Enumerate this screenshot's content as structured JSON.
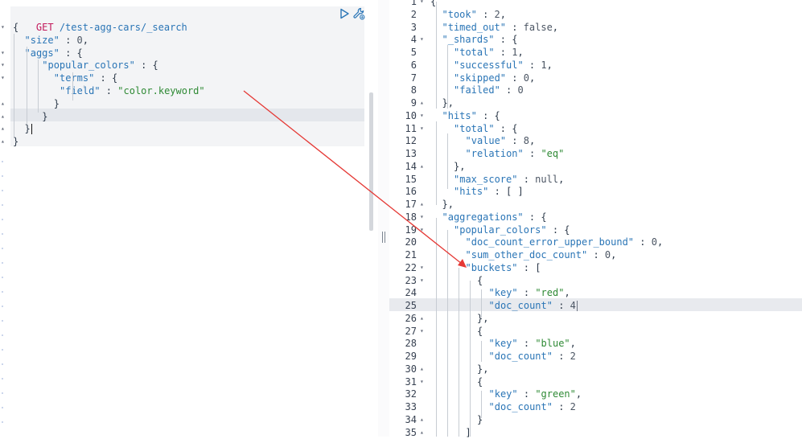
{
  "request": {
    "method": "GET",
    "path": "/test-agg-cars/_search"
  },
  "colors": {
    "method": "#c2185b",
    "key": "#2a75b6",
    "string": "#2f8a35",
    "arrow": "#e53935",
    "highlight": "#f3f4f6"
  },
  "icons": [
    "play-icon",
    "wrench-icon"
  ],
  "editor_lines": [
    [
      {
        "t": "pun",
        "v": "{"
      }
    ],
    [
      {
        "t": "key",
        "v": "\"size\""
      },
      {
        "t": "pun",
        "v": " : "
      },
      {
        "t": "num",
        "v": "0"
      },
      {
        "t": "pun",
        "v": ","
      }
    ],
    [
      {
        "t": "key",
        "v": "\"aggs\""
      },
      {
        "t": "pun",
        "v": " : {"
      }
    ],
    [
      {
        "t": "key",
        "v": "\"popular_colors\""
      },
      {
        "t": "pun",
        "v": " : {"
      }
    ],
    [
      {
        "t": "key",
        "v": "\"terms\""
      },
      {
        "t": "pun",
        "v": " : {"
      }
    ],
    [
      {
        "t": "key",
        "v": "\"field\""
      },
      {
        "t": "pun",
        "v": " : "
      },
      {
        "t": "str",
        "v": "\"color.keyword\""
      }
    ],
    [
      {
        "t": "pun",
        "v": "}"
      }
    ],
    [
      {
        "t": "pun",
        "v": "}"
      }
    ],
    [
      {
        "t": "pun",
        "v": "}"
      }
    ],
    [
      {
        "t": "pun",
        "v": "}"
      }
    ]
  ],
  "response_lines": [
    {
      "n": "1",
      "f": "▾",
      "c": [
        {
          "t": "pun",
          "v": "{"
        }
      ]
    },
    {
      "n": "2",
      "f": "",
      "c": [
        {
          "t": "key",
          "v": "\"took\""
        },
        {
          "t": "pun",
          "v": " : "
        },
        {
          "t": "num",
          "v": "2"
        },
        {
          "t": "pun",
          "v": ","
        }
      ]
    },
    {
      "n": "3",
      "f": "",
      "c": [
        {
          "t": "key",
          "v": "\"timed_out\""
        },
        {
          "t": "pun",
          "v": " : "
        },
        {
          "t": "kw",
          "v": "false"
        },
        {
          "t": "pun",
          "v": ","
        }
      ]
    },
    {
      "n": "4",
      "f": "▾",
      "c": [
        {
          "t": "key",
          "v": "\"_shards\""
        },
        {
          "t": "pun",
          "v": " : {"
        }
      ]
    },
    {
      "n": "5",
      "f": "",
      "c": [
        {
          "t": "key",
          "v": "\"total\""
        },
        {
          "t": "pun",
          "v": " : "
        },
        {
          "t": "num",
          "v": "1"
        },
        {
          "t": "pun",
          "v": ","
        }
      ]
    },
    {
      "n": "6",
      "f": "",
      "c": [
        {
          "t": "key",
          "v": "\"successful\""
        },
        {
          "t": "pun",
          "v": " : "
        },
        {
          "t": "num",
          "v": "1"
        },
        {
          "t": "pun",
          "v": ","
        }
      ]
    },
    {
      "n": "7",
      "f": "",
      "c": [
        {
          "t": "key",
          "v": "\"skipped\""
        },
        {
          "t": "pun",
          "v": " : "
        },
        {
          "t": "num",
          "v": "0"
        },
        {
          "t": "pun",
          "v": ","
        }
      ]
    },
    {
      "n": "8",
      "f": "",
      "c": [
        {
          "t": "key",
          "v": "\"failed\""
        },
        {
          "t": "pun",
          "v": " : "
        },
        {
          "t": "num",
          "v": "0"
        }
      ]
    },
    {
      "n": "9",
      "f": "▴",
      "c": [
        {
          "t": "pun",
          "v": "},"
        }
      ]
    },
    {
      "n": "10",
      "f": "▾",
      "c": [
        {
          "t": "key",
          "v": "\"hits\""
        },
        {
          "t": "pun",
          "v": " : {"
        }
      ]
    },
    {
      "n": "11",
      "f": "▾",
      "c": [
        {
          "t": "key",
          "v": "\"total\""
        },
        {
          "t": "pun",
          "v": " : {"
        }
      ]
    },
    {
      "n": "12",
      "f": "",
      "c": [
        {
          "t": "key",
          "v": "\"value\""
        },
        {
          "t": "pun",
          "v": " : "
        },
        {
          "t": "num",
          "v": "8"
        },
        {
          "t": "pun",
          "v": ","
        }
      ]
    },
    {
      "n": "13",
      "f": "",
      "c": [
        {
          "t": "key",
          "v": "\"relation\""
        },
        {
          "t": "pun",
          "v": " : "
        },
        {
          "t": "str",
          "v": "\"eq\""
        }
      ]
    },
    {
      "n": "14",
      "f": "▴",
      "c": [
        {
          "t": "pun",
          "v": "},"
        }
      ]
    },
    {
      "n": "15",
      "f": "",
      "c": [
        {
          "t": "key",
          "v": "\"max_score\""
        },
        {
          "t": "pun",
          "v": " : "
        },
        {
          "t": "kw",
          "v": "null"
        },
        {
          "t": "pun",
          "v": ","
        }
      ]
    },
    {
      "n": "16",
      "f": "",
      "c": [
        {
          "t": "key",
          "v": "\"hits\""
        },
        {
          "t": "pun",
          "v": " : [ ]"
        }
      ]
    },
    {
      "n": "17",
      "f": "▴",
      "c": [
        {
          "t": "pun",
          "v": "},"
        }
      ]
    },
    {
      "n": "18",
      "f": "▾",
      "c": [
        {
          "t": "key",
          "v": "\"aggregations\""
        },
        {
          "t": "pun",
          "v": " : {"
        }
      ]
    },
    {
      "n": "19",
      "f": "▾",
      "c": [
        {
          "t": "key",
          "v": "\"popular_colors\""
        },
        {
          "t": "pun",
          "v": " : {"
        }
      ]
    },
    {
      "n": "20",
      "f": "",
      "c": [
        {
          "t": "key",
          "v": "\"doc_count_error_upper_bound\""
        },
        {
          "t": "pun",
          "v": " : "
        },
        {
          "t": "num",
          "v": "0"
        },
        {
          "t": "pun",
          "v": ","
        }
      ]
    },
    {
      "n": "21",
      "f": "",
      "c": [
        {
          "t": "key",
          "v": "\"sum_other_doc_count\""
        },
        {
          "t": "pun",
          "v": " : "
        },
        {
          "t": "num",
          "v": "0"
        },
        {
          "t": "pun",
          "v": ","
        }
      ]
    },
    {
      "n": "22",
      "f": "▾",
      "c": [
        {
          "t": "key",
          "v": "\"buckets\""
        },
        {
          "t": "pun",
          "v": " : ["
        }
      ]
    },
    {
      "n": "23",
      "f": "▾",
      "c": [
        {
          "t": "pun",
          "v": "{"
        }
      ]
    },
    {
      "n": "24",
      "f": "",
      "c": [
        {
          "t": "key",
          "v": "\"key\""
        },
        {
          "t": "pun",
          "v": " : "
        },
        {
          "t": "str",
          "v": "\"red\""
        },
        {
          "t": "pun",
          "v": ","
        }
      ]
    },
    {
      "n": "25",
      "f": "",
      "c": [
        {
          "t": "key",
          "v": "\"doc_count\""
        },
        {
          "t": "pun",
          "v": " : "
        },
        {
          "t": "num",
          "v": "4"
        }
      ]
    },
    {
      "n": "26",
      "f": "▴",
      "c": [
        {
          "t": "pun",
          "v": "},"
        }
      ]
    },
    {
      "n": "27",
      "f": "▾",
      "c": [
        {
          "t": "pun",
          "v": "{"
        }
      ]
    },
    {
      "n": "28",
      "f": "",
      "c": [
        {
          "t": "key",
          "v": "\"key\""
        },
        {
          "t": "pun",
          "v": " : "
        },
        {
          "t": "str",
          "v": "\"blue\""
        },
        {
          "t": "pun",
          "v": ","
        }
      ]
    },
    {
      "n": "29",
      "f": "",
      "c": [
        {
          "t": "key",
          "v": "\"doc_count\""
        },
        {
          "t": "pun",
          "v": " : "
        },
        {
          "t": "num",
          "v": "2"
        }
      ]
    },
    {
      "n": "30",
      "f": "▴",
      "c": [
        {
          "t": "pun",
          "v": "},"
        }
      ]
    },
    {
      "n": "31",
      "f": "▾",
      "c": [
        {
          "t": "pun",
          "v": "{"
        }
      ]
    },
    {
      "n": "32",
      "f": "",
      "c": [
        {
          "t": "key",
          "v": "\"key\""
        },
        {
          "t": "pun",
          "v": " : "
        },
        {
          "t": "str",
          "v": "\"green\""
        },
        {
          "t": "pun",
          "v": ","
        }
      ]
    },
    {
      "n": "33",
      "f": "",
      "c": [
        {
          "t": "key",
          "v": "\"doc_count\""
        },
        {
          "t": "pun",
          "v": " : "
        },
        {
          "t": "num",
          "v": "2"
        }
      ]
    },
    {
      "n": "34",
      "f": "▴",
      "c": [
        {
          "t": "pun",
          "v": "}"
        }
      ]
    },
    {
      "n": "35",
      "f": "▴",
      "c": [
        {
          "t": "pun",
          "v": "]"
        }
      ]
    }
  ]
}
